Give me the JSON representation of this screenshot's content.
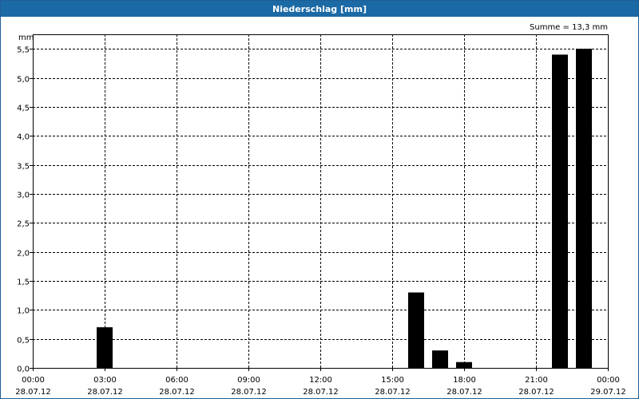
{
  "window": {
    "title": "Niederschlag [mm]"
  },
  "chart_data": {
    "type": "bar",
    "title": "Niederschlag [mm]",
    "unit_label": "mm",
    "sum_label": "Summe = 13,3 mm",
    "ylim": [
      0,
      5.75
    ],
    "y_ticks": [
      "0,0",
      "0,5",
      "1,0",
      "1,5",
      "2,0",
      "2,5",
      "3,0",
      "3,5",
      "4,0",
      "4,5",
      "5,0",
      "5,5"
    ],
    "y_tick_values": [
      0,
      0.5,
      1,
      1.5,
      2,
      2.5,
      3,
      3.5,
      4,
      4.5,
      5,
      5.5
    ],
    "x_range_hours": [
      0,
      24
    ],
    "x_ticks": [
      {
        "time": "00:00",
        "date": "28.07.12",
        "hour": 0
      },
      {
        "time": "03:00",
        "date": "28.07.12",
        "hour": 3
      },
      {
        "time": "06:00",
        "date": "28.07.12",
        "hour": 6
      },
      {
        "time": "09:00",
        "date": "28.07.12",
        "hour": 9
      },
      {
        "time": "12:00",
        "date": "28.07.12",
        "hour": 12
      },
      {
        "time": "15:00",
        "date": "28.07.12",
        "hour": 15
      },
      {
        "time": "18:00",
        "date": "28.07.12",
        "hour": 18
      },
      {
        "time": "21:00",
        "date": "28.07.12",
        "hour": 21
      },
      {
        "time": "00:00",
        "date": "29.07.12",
        "hour": 24
      }
    ],
    "bars": [
      {
        "hour": 3,
        "value": 0.7
      },
      {
        "hour": 16,
        "value": 1.3
      },
      {
        "hour": 17,
        "value": 0.3
      },
      {
        "hour": 18,
        "value": 0.1
      },
      {
        "hour": 22,
        "value": 5.4
      },
      {
        "hour": 23,
        "value": 5.5
      }
    ],
    "grid": true,
    "colors": {
      "bar": "#000000",
      "grid": "#000000",
      "title_bg": "#1c6aa5"
    }
  }
}
